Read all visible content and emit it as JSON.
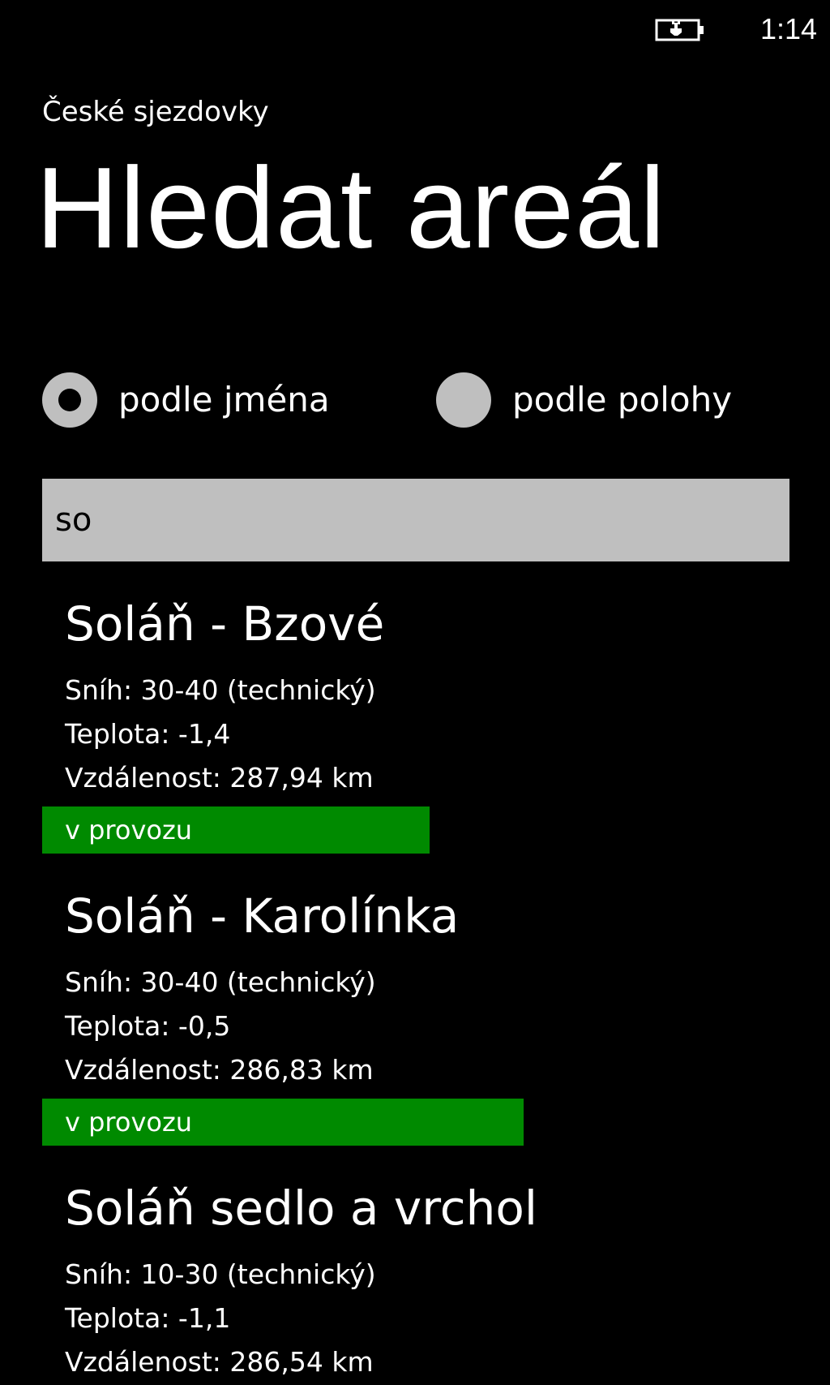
{
  "status_bar": {
    "time": "1:14",
    "battery_icon": "battery-charging-icon"
  },
  "header": {
    "app_title": "České sjezdovky",
    "page_title": "Hledat areál"
  },
  "search_mode": {
    "options": [
      {
        "label": "podle jména",
        "selected": true
      },
      {
        "label": "podle polohy",
        "selected": false
      }
    ]
  },
  "search": {
    "value": "so",
    "placeholder": ""
  },
  "results": [
    {
      "name": "Soláň - Bzové",
      "snow": "Sníh: 30-40 (technický)",
      "temperature": "Teplota: -1,4",
      "distance": "Vzdálenost: 287,94 km",
      "status": "v provozu"
    },
    {
      "name": "Soláň - Karolínka",
      "snow": "Sníh: 30-40 (technický)",
      "temperature": "Teplota: -0,5",
      "distance": "Vzdálenost: 286,83 km",
      "status": "v provozu"
    },
    {
      "name": "Soláň sedlo a vrchol",
      "snow": "Sníh: 10-30 (technický)",
      "temperature": "Teplota: -1,1",
      "distance": "Vzdálenost: 286,54 km"
    }
  ],
  "colors": {
    "background": "#000000",
    "text": "#ffffff",
    "control_gray": "#bfbfbf",
    "status_green": "#008a00"
  }
}
